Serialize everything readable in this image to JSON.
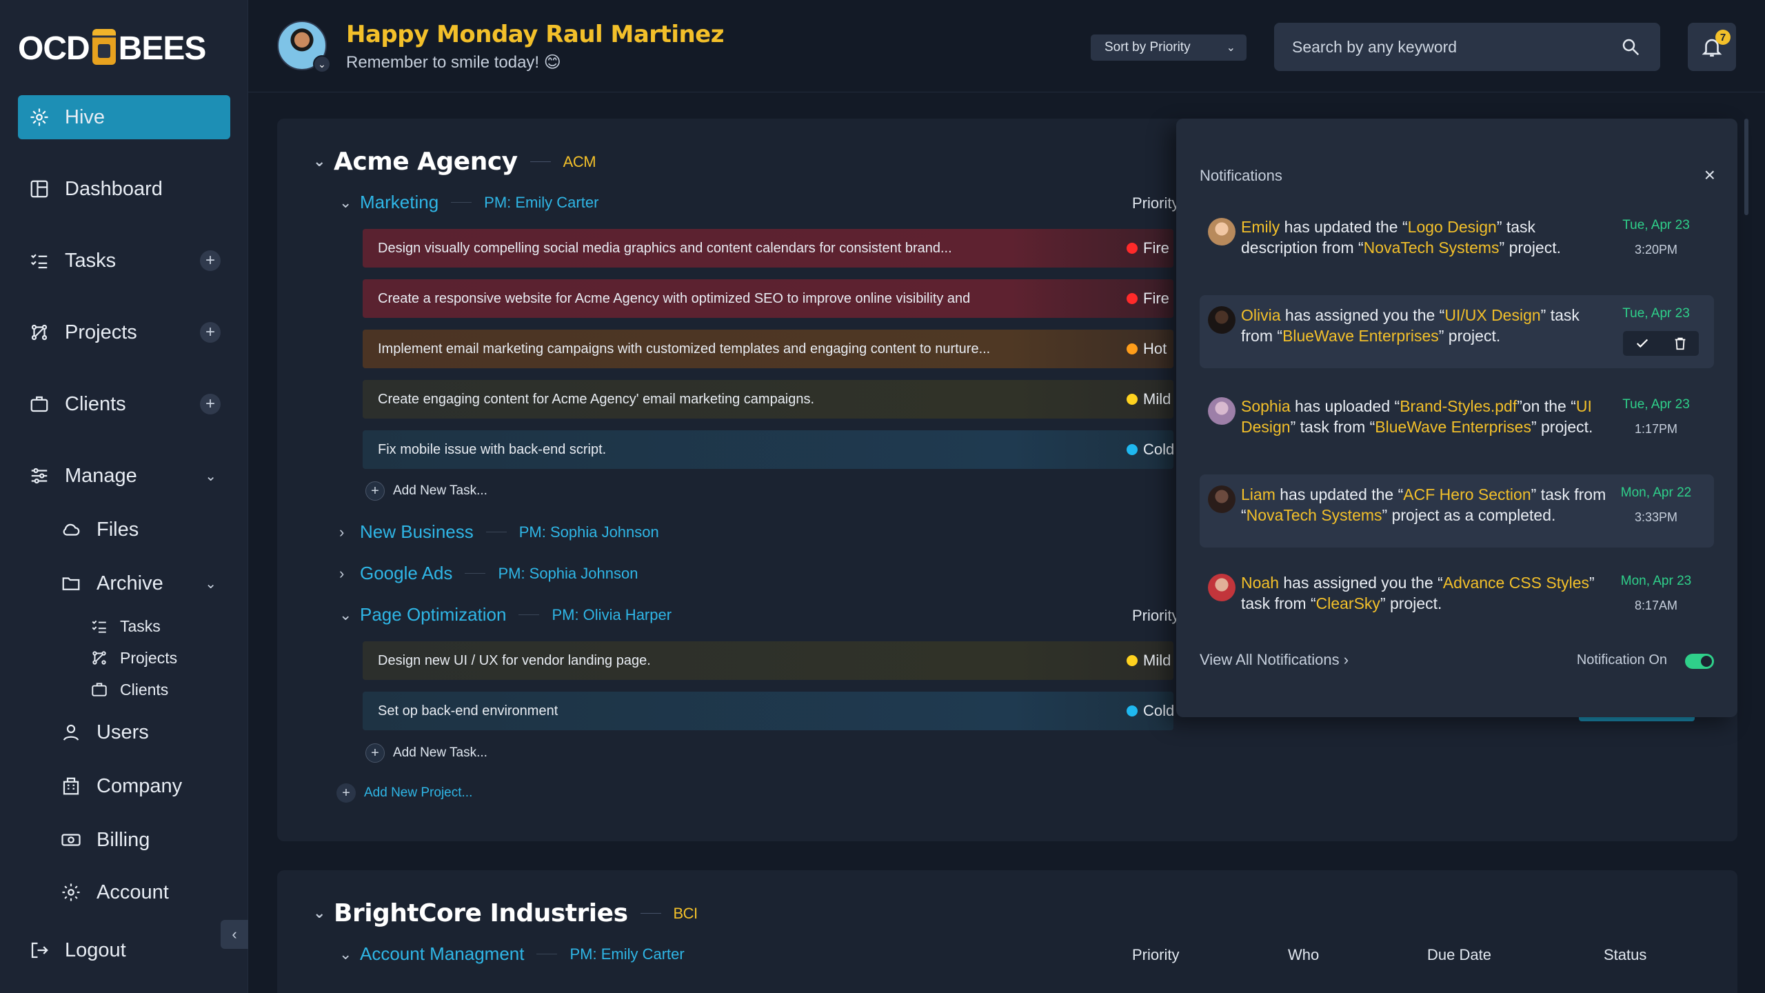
{
  "brand": {
    "logo_left": "OCD",
    "logo_right": "BEES"
  },
  "sidebar": {
    "items": [
      {
        "label": "Hive"
      },
      {
        "label": "Dashboard"
      },
      {
        "label": "Tasks",
        "plus": "+"
      },
      {
        "label": "Projects",
        "plus": "+"
      },
      {
        "label": "Clients",
        "plus": "+"
      },
      {
        "label": "Manage",
        "chev": "⌄"
      },
      {
        "label": "Files"
      },
      {
        "label": "Archive",
        "chev": "⌄"
      },
      {
        "label": "Tasks"
      },
      {
        "label": "Projects"
      },
      {
        "label": "Clients"
      },
      {
        "label": "Users"
      },
      {
        "label": "Company"
      },
      {
        "label": "Billing"
      },
      {
        "label": "Account"
      },
      {
        "label": "Logout"
      }
    ],
    "collapse": "‹"
  },
  "header": {
    "greeting": "Happy Monday Raul Martinez",
    "subtitle": "Remember to smile today! 😊",
    "sort_label": "Sort by Priority",
    "search_placeholder": "Search by any keyword",
    "notif_count": "7"
  },
  "companies": [
    {
      "name": "Acme Agency",
      "code": "ACM",
      "projects": [
        {
          "name": "Marketing",
          "pm": "PM: Emily Carter",
          "priority_header": "Priority",
          "tasks": [
            {
              "text": "Design visually compelling social media graphics and content calendars for consistent brand...",
              "priority": "Fire"
            },
            {
              "text": "Create a responsive website for Acme Agency with optimized SEO to improve online visibility and",
              "priority": "Fire"
            },
            {
              "text": "Implement email marketing campaigns with customized templates and engaging content to nurture...",
              "priority": "Hot"
            },
            {
              "text": "Create engaging content for Acme Agency' email marketing campaigns.",
              "priority": "Mild"
            },
            {
              "text": "Fix mobile issue with back-end script.",
              "priority": "Cold"
            }
          ],
          "add_task": "Add New Task..."
        },
        {
          "name": "New Business",
          "pm": "PM: Sophia Johnson"
        },
        {
          "name": "Google Ads",
          "pm": "PM: Sophia Johnson"
        },
        {
          "name": "Page Optimization",
          "pm": "PM: Olivia Harper",
          "priority_header": "Priority",
          "tasks": [
            {
              "text": "Design new UI / UX for vendor landing page.",
              "priority": "Mild"
            },
            {
              "text": "Set op back-end environment",
              "priority": "Cold"
            }
          ],
          "add_task": "Add New Task..."
        }
      ],
      "add_project": "Add New Project..."
    },
    {
      "name": "BrightCore Industries",
      "code": "BCI",
      "projects": [
        {
          "name": "Account Managment",
          "pm": "PM: Emily Carter"
        }
      ],
      "columns": [
        "Priority",
        "Who",
        "Due Date",
        "Status"
      ]
    }
  ],
  "priority_colors": {
    "Fire": "#ff2a2a",
    "Hot": "#ff9d1a",
    "Mild": "#ffd21f",
    "Cold": "#1fb8f0"
  },
  "notifications": {
    "title": "Notifications",
    "close": "×",
    "items": [
      {
        "user": "Emily",
        "pre": " has updated the “",
        "t1": "Logo Design",
        "mid": "” task description from “",
        "t2": "NovaTech Systems",
        "post": "” project.",
        "date": "Tue, Apr 23",
        "time": "3:20PM"
      },
      {
        "user": "Olivia",
        "pre": " has assigned you the “",
        "t1": "UI/UX Design",
        "mid": "” task from “",
        "t2": "BlueWave Enterprises",
        "post": "” project.",
        "date": "Tue, Apr 23",
        "time": ""
      },
      {
        "user": "Sophia",
        "pre": " has uploaded “",
        "t1": "Brand-Styles.pdf",
        "mid": "”on the “",
        "t2": "UI Design",
        "mid2": "” task from “",
        "t3": "BlueWave Enterprises",
        "post": "” project.",
        "date": "Tue, Apr 23",
        "time": "1:17PM"
      },
      {
        "user": "Liam",
        "pre": " has updated the “",
        "t1": "ACF Hero Section",
        "mid": "” task from “",
        "t2": "NovaTech Systems",
        "post": "” project as a completed.",
        "date": "Mon, Apr 22",
        "time": "3:33PM"
      },
      {
        "user": "Noah",
        "pre": " has assigned you the “",
        "t1": "Advance CSS Styles",
        "mid": "” task from “",
        "t2": "ClearSky",
        "post": "” project.",
        "date": "Mon, Apr 23",
        "time": "8:17AM"
      }
    ],
    "view_all": "View All Notifications  ›",
    "toggle_label": "Notification On"
  }
}
